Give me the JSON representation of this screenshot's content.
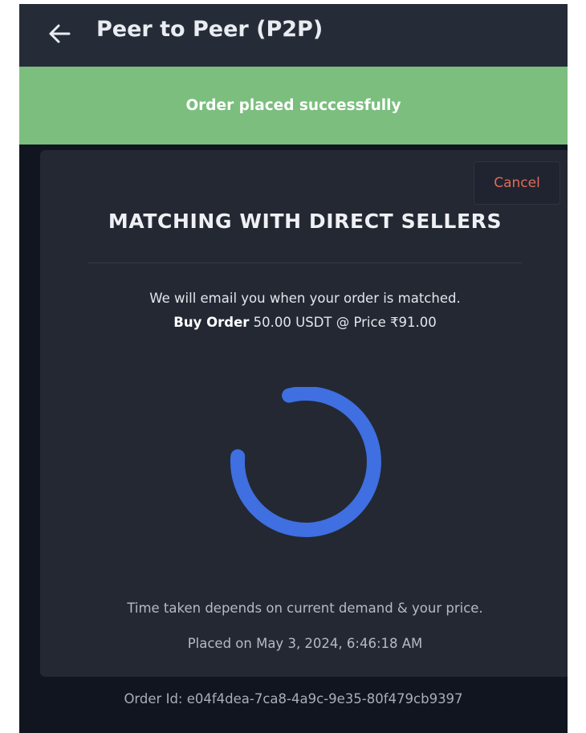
{
  "app_bar": {
    "title": "Peer to Peer (P2P)",
    "back_icon": "arrow-left-icon"
  },
  "banner": {
    "text": "Order placed successfully",
    "color": "#7bbe7e"
  },
  "card": {
    "cancel_label": "Cancel",
    "heading": "MATCHING WITH DIRECT SELLERS",
    "email_notice": "We will email you when your order is matched.",
    "order_type": "Buy Order",
    "order_amount": "50.00 USDT @ Price ₹91.00",
    "spinner_icon": "loading-spinner-icon",
    "demand_notice": "Time taken depends on current demand & your price.",
    "placed_on": "Placed on May 3, 2024, 6:46:18 AM"
  },
  "order": {
    "id_text": "Order Id: e04f4dea-7ca8-4a9c-9e35-80f479cb9397"
  },
  "colors": {
    "accent": "#3f6fe0",
    "cancel": "#e06a58",
    "background": "#111520",
    "card": "#232833",
    "app_bar": "#262c37"
  }
}
